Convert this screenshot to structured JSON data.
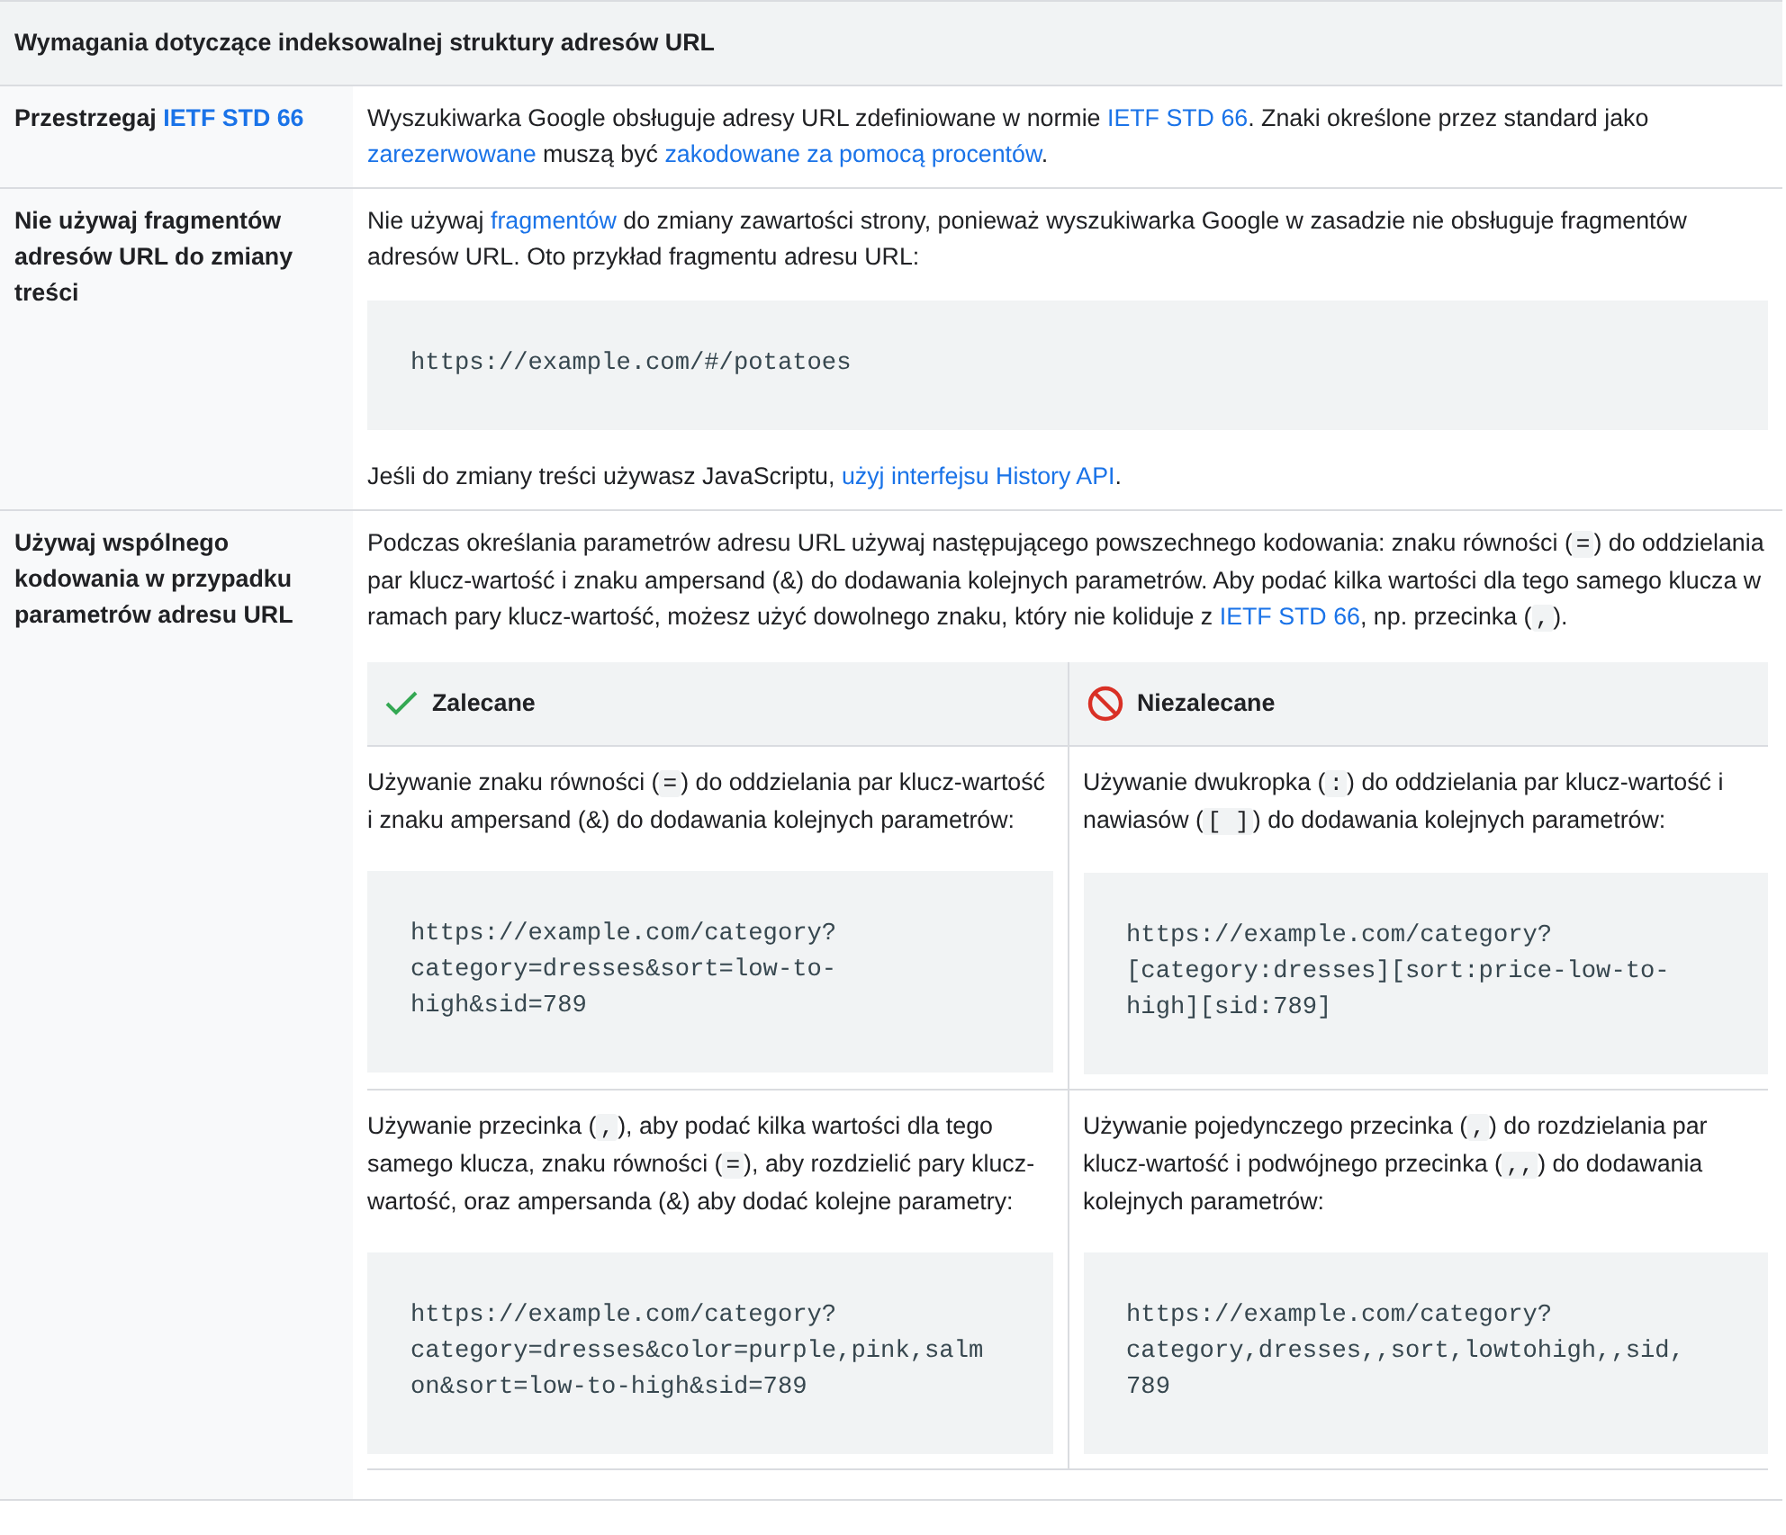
{
  "table": {
    "title": "Wymagania dotyczące indeksowalnej struktury adresów URL",
    "rows": [
      {
        "label": [
          {
            "kind": "text",
            "text": "Przestrzegaj "
          },
          {
            "kind": "link",
            "text": "IETF STD 66"
          }
        ],
        "content": [
          {
            "kind": "paragraph",
            "segments": [
              {
                "kind": "text",
                "text": "Wyszukiwarka Google obsługuje adresy URL zdefiniowane w normie "
              },
              {
                "kind": "link",
                "text": "IETF STD 66"
              },
              {
                "kind": "text",
                "text": ". Znaki określone przez standard jako "
              },
              {
                "kind": "link",
                "text": "zarezerwowane"
              },
              {
                "kind": "text",
                "text": " muszą być "
              },
              {
                "kind": "link",
                "text": "zakodowane za pomocą procentów"
              },
              {
                "kind": "text",
                "text": "."
              }
            ]
          }
        ]
      },
      {
        "label": [
          {
            "kind": "text",
            "text": "Nie używaj fragmentów adresów URL do zmiany treści"
          }
        ],
        "content": [
          {
            "kind": "paragraph",
            "segments": [
              {
                "kind": "text",
                "text": "Nie używaj "
              },
              {
                "kind": "link",
                "text": "fragmentów"
              },
              {
                "kind": "text",
                "text": " do zmiany zawartości strony, ponieważ wyszukiwarka Google w zasadzie nie obsługuje fragmentów adresów URL. Oto przykład fragmentu adresu URL:"
              }
            ]
          },
          {
            "kind": "code",
            "text": "https://example.com/#/potatoes"
          },
          {
            "kind": "paragraph",
            "segments": [
              {
                "kind": "text",
                "text": "Jeśli do zmiany treści używasz JavaScriptu, "
              },
              {
                "kind": "link",
                "text": "użyj interfejsu History API"
              },
              {
                "kind": "text",
                "text": "."
              }
            ]
          }
        ]
      },
      {
        "label": [
          {
            "kind": "text",
            "text": "Używaj wspólnego kodowania w przypadku parametrów adresu URL"
          }
        ],
        "content": [
          {
            "kind": "paragraph",
            "segments": [
              {
                "kind": "text",
                "text": "Podczas określania parametrów adresu URL używaj następującego powszechnego kodowania: znaku równości ("
              },
              {
                "kind": "code",
                "text": "="
              },
              {
                "kind": "text",
                "text": ") do oddzielania par klucz-wartość i znaku ampersand (&) do dodawania kolejnych parametrów. Aby podać kilka wartości dla tego samego klucza w ramach pary klucz-wartość, możesz użyć dowolnego znaku, który nie koliduje z "
              },
              {
                "kind": "link",
                "text": "IETF STD 66"
              },
              {
                "kind": "text",
                "text": ", np. przecinka ("
              },
              {
                "kind": "code",
                "text": ","
              },
              {
                "kind": "text",
                "text": ")."
              }
            ]
          },
          {
            "kind": "comparison",
            "columns": [
              {
                "kind": "recommended",
                "heading": "Zalecane"
              },
              {
                "kind": "not_recommended",
                "heading": "Niezalecane"
              }
            ],
            "rows": [
              [
                {
                  "segments": [
                    {
                      "kind": "text",
                      "text": "Używanie znaku równości ("
                    },
                    {
                      "kind": "code",
                      "text": "="
                    },
                    {
                      "kind": "text",
                      "text": ") do oddzielania par klucz-wartość i znaku ampersand (&) do dodawania kolejnych parametrów:"
                    }
                  ],
                  "code": "https://example.com/category?\ncategory=dresses&sort=low-to-\nhigh&sid=789"
                },
                {
                  "segments": [
                    {
                      "kind": "text",
                      "text": "Używanie dwukropka ("
                    },
                    {
                      "kind": "code",
                      "text": ":"
                    },
                    {
                      "kind": "text",
                      "text": ") do oddzielania par klucz-wartość i nawiasów ("
                    },
                    {
                      "kind": "code",
                      "text": "[ ]"
                    },
                    {
                      "kind": "text",
                      "text": ") do dodawania kolejnych parametrów:"
                    }
                  ],
                  "code": "https://example.com/category?\n[category:dresses][sort:price-low-to-\nhigh][sid:789]"
                }
              ],
              [
                {
                  "segments": [
                    {
                      "kind": "text",
                      "text": "Używanie przecinka ("
                    },
                    {
                      "kind": "code",
                      "text": ","
                    },
                    {
                      "kind": "text",
                      "text": "), aby podać kilka wartości dla tego samego klucza, znaku równości ("
                    },
                    {
                      "kind": "code",
                      "text": "="
                    },
                    {
                      "kind": "text",
                      "text": "), aby rozdzielić pary klucz-wartość, oraz ampersanda (&) aby dodać kolejne parametry:"
                    }
                  ],
                  "code": "https://example.com/category?\ncategory=dresses&color=purple,pink,salm\non&sort=low-to-high&sid=789"
                },
                {
                  "segments": [
                    {
                      "kind": "text",
                      "text": "Używanie pojedynczego przecinka ("
                    },
                    {
                      "kind": "code",
                      "text": ","
                    },
                    {
                      "kind": "text",
                      "text": ") do rozdzielania par klucz-wartość i podwójnego przecinka ("
                    },
                    {
                      "kind": "code",
                      "text": ",,"
                    },
                    {
                      "kind": "text",
                      "text": ") do dodawania kolejnych parametrów:"
                    }
                  ],
                  "code": "https://example.com/category?\ncategory,dresses,,sort,lowtohigh,,sid,\n789"
                }
              ]
            ]
          }
        ]
      }
    ]
  }
}
